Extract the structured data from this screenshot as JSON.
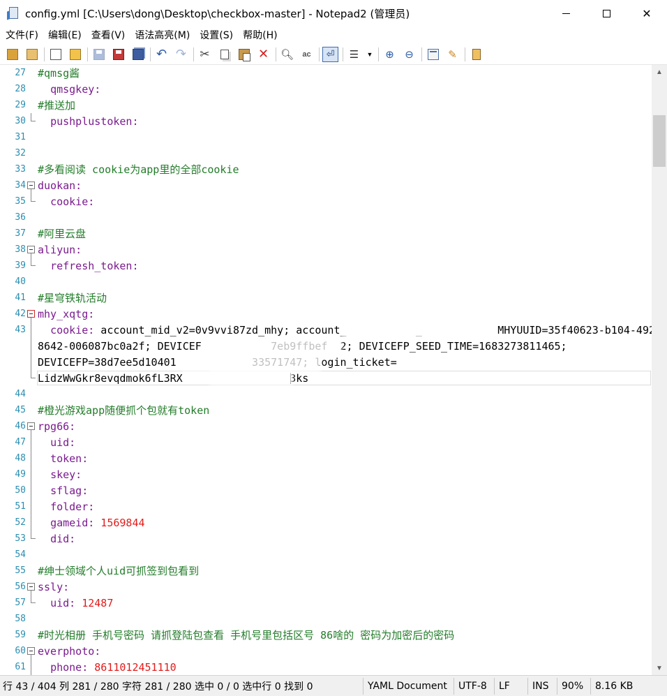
{
  "window": {
    "title": "config.yml [C:\\Users\\dong\\Desktop\\checkbox-master] - Notepad2 (管理员)",
    "minimize_glyph": "—",
    "maximize_glyph": "☐",
    "close_glyph": "✕"
  },
  "menu": [
    "文件(F)",
    "编辑(E)",
    "查看(V)",
    "语法高亮(M)",
    "设置(S)",
    "帮助(H)"
  ],
  "toolbar": {
    "icons": [
      "browse-icon",
      "find-file-icon",
      "new-file-icon",
      "open-file-icon",
      "save-icon",
      "save-as-icon",
      "save-copy-icon",
      "undo-icon",
      "redo-icon",
      "cut-icon",
      "copy-icon",
      "paste-icon",
      "delete-icon",
      "find-icon",
      "replace-icon",
      "word-wrap-icon",
      "list-icon",
      "dropdown-arrow-icon",
      "zoom-in-icon",
      "zoom-out-icon",
      "scheme-icon",
      "settings-icon",
      "exit-icon"
    ]
  },
  "editor": {
    "lines": [
      {
        "n": "27",
        "key": "",
        "comment": "#qmsg酱",
        "value": ""
      },
      {
        "n": "28",
        "indent": "  ",
        "key": "qmsgkey:",
        "value": ""
      },
      {
        "n": "29",
        "comment": "#推送加"
      },
      {
        "n": "30",
        "indent": "  ",
        "key": "pushplustoken:",
        "value": ""
      },
      {
        "n": "31"
      },
      {
        "n": "32"
      },
      {
        "n": "33",
        "comment": "#多看阅读 cookie为app里的全部cookie"
      },
      {
        "n": "34",
        "key": "duokan:"
      },
      {
        "n": "35",
        "indent": "  ",
        "key": "cookie:"
      },
      {
        "n": "36"
      },
      {
        "n": "37",
        "comment": "#阿里云盘"
      },
      {
        "n": "38",
        "key": "aliyun:"
      },
      {
        "n": "39",
        "indent": "  ",
        "key": "refresh_token:"
      },
      {
        "n": "40"
      },
      {
        "n": "41",
        "comment": "#星穹铁轨活动"
      },
      {
        "n": "42",
        "key": "mhy_xqtg:"
      },
      {
        "n": "43",
        "indent": "  ",
        "key": "cookie:",
        "value": " account_mid_v2=0v9vvi87zd_mhy; account_           _            MHYUUID=35f40623-b104-4923-"
      },
      {
        "n": "",
        "value": "8642-006087bc0a2f; DEVICEF           7eb9ffbef  2; DEVICEFP_SEED_TIME=1683273811465;"
      },
      {
        "n": "",
        "value": "DEVICEFP=38d7ee5d10401            33571747; login_ticket="
      },
      {
        "n": "",
        "value": "LidzWwGkr8evqdmok6fL3RX                 3ks"
      },
      {
        "n": "44"
      },
      {
        "n": "45",
        "comment": "#橙光游戏app随便抓个包就有token"
      },
      {
        "n": "46",
        "key": "rpg66:"
      },
      {
        "n": "47",
        "indent": "  ",
        "key": "uid:"
      },
      {
        "n": "48",
        "indent": "  ",
        "key": "token:"
      },
      {
        "n": "49",
        "indent": "  ",
        "key": "skey:"
      },
      {
        "n": "50",
        "indent": "  ",
        "key": "sflag:"
      },
      {
        "n": "51",
        "indent": "  ",
        "key": "folder:"
      },
      {
        "n": "52",
        "indent": "  ",
        "key": "gameid:",
        "num": " 1569844"
      },
      {
        "n": "53",
        "indent": "  ",
        "key": "did:"
      },
      {
        "n": "54"
      },
      {
        "n": "55",
        "comment": "#绅士领域个人uid可抓签到包看到"
      },
      {
        "n": "56",
        "key": "ssly:"
      },
      {
        "n": "57",
        "indent": "  ",
        "key": "uid:",
        "num": " 12487"
      },
      {
        "n": "58"
      },
      {
        "n": "59",
        "comment": "#时光相册 手机号密码 请抓登陆包查看 手机号里包括区号 86啥的 密码为加密后的密码"
      },
      {
        "n": "60",
        "key": "everphoto:"
      },
      {
        "n": "61",
        "indent": "  ",
        "key": "phone:",
        "num": " 8611012451110"
      }
    ]
  },
  "status": {
    "main": "行 43 / 404  列 281 / 280  字符 281 / 280  选中 0 / 0  选中行 0  找到 0",
    "lexer": "YAML Document",
    "encoding": "UTF-8",
    "eol": "LF",
    "mode": "INS",
    "zoom": "90%",
    "size": "8.16 KB"
  }
}
